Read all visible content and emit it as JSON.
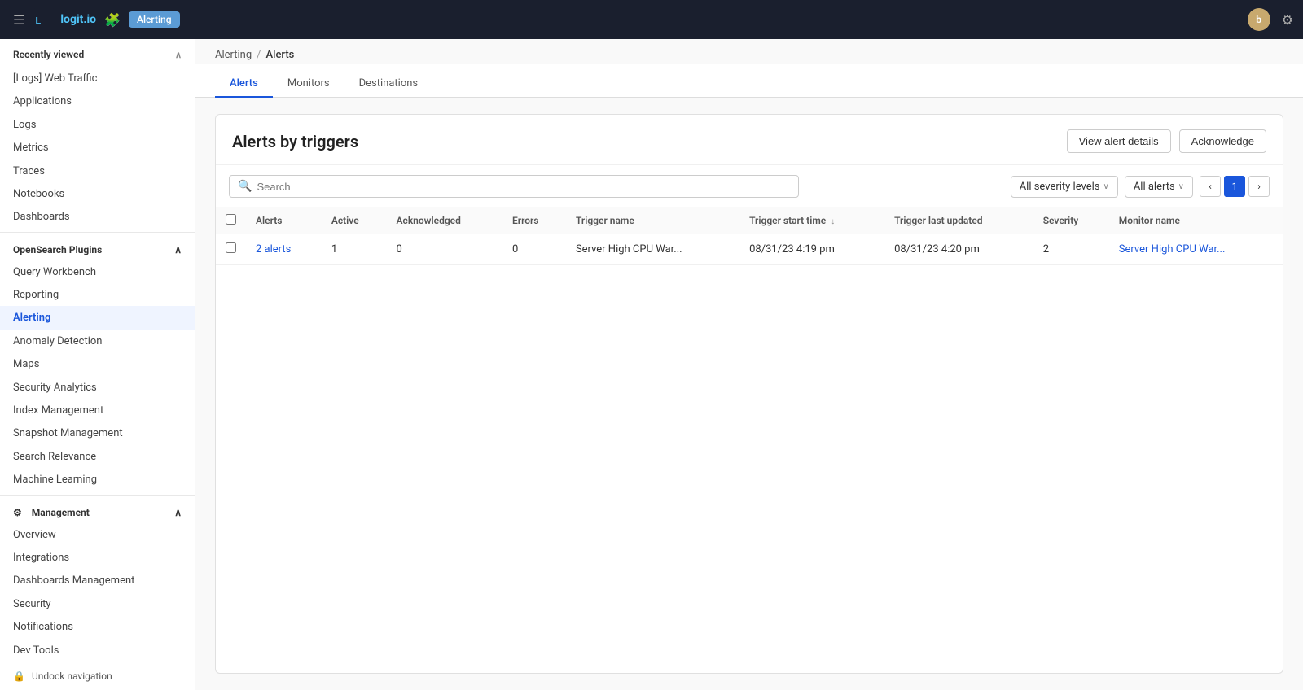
{
  "topbar": {
    "logo_text": "logit.io",
    "menu_icon": "☰",
    "puzzle_icon": "🧩",
    "alerting_badge": "Alerting",
    "avatar_text": "b",
    "settings_icon": "⚙"
  },
  "sidebar": {
    "recently_viewed_label": "Recently viewed",
    "recently_viewed_items": [
      "[Logs] Web Traffic",
      "Applications",
      "Logs",
      "Metrics",
      "Traces",
      "Notebooks",
      "Dashboards"
    ],
    "opensearch_plugins_label": "OpenSearch Plugins",
    "plugin_items": [
      "Query Workbench",
      "Reporting",
      "Alerting",
      "Anomaly Detection",
      "Maps",
      "Security Analytics",
      "Index Management",
      "Snapshot Management",
      "Search Relevance",
      "Machine Learning"
    ],
    "management_label": "Management",
    "management_items": [
      "Overview",
      "Integrations",
      "Dashboards Management",
      "Security",
      "Notifications",
      "Dev Tools"
    ],
    "unlock_nav_label": "Undock navigation"
  },
  "breadcrumb": {
    "parent": "Alerting",
    "current": "Alerts"
  },
  "tabs": [
    {
      "label": "Alerts",
      "active": true
    },
    {
      "label": "Monitors",
      "active": false
    },
    {
      "label": "Destinations",
      "active": false
    }
  ],
  "panel": {
    "title": "Alerts by triggers",
    "view_alert_details_btn": "View alert details",
    "acknowledge_btn": "Acknowledge"
  },
  "toolbar": {
    "search_placeholder": "Search",
    "severity_filter_label": "All severity levels",
    "alerts_filter_label": "All alerts",
    "page_number": "1"
  },
  "table": {
    "columns": [
      "Alerts",
      "Active",
      "Acknowledged",
      "Errors",
      "Trigger name",
      "Trigger start time",
      "Trigger last updated",
      "Severity",
      "Monitor name"
    ],
    "rows": [
      {
        "alerts": "2 alerts",
        "active": "1",
        "acknowledged": "0",
        "errors": "0",
        "trigger_name": "Server High CPU War...",
        "trigger_start_time": "08/31/23 4:19 pm",
        "trigger_last_updated": "08/31/23 4:20 pm",
        "severity": "2",
        "monitor_name": "Server High CPU War..."
      }
    ]
  }
}
